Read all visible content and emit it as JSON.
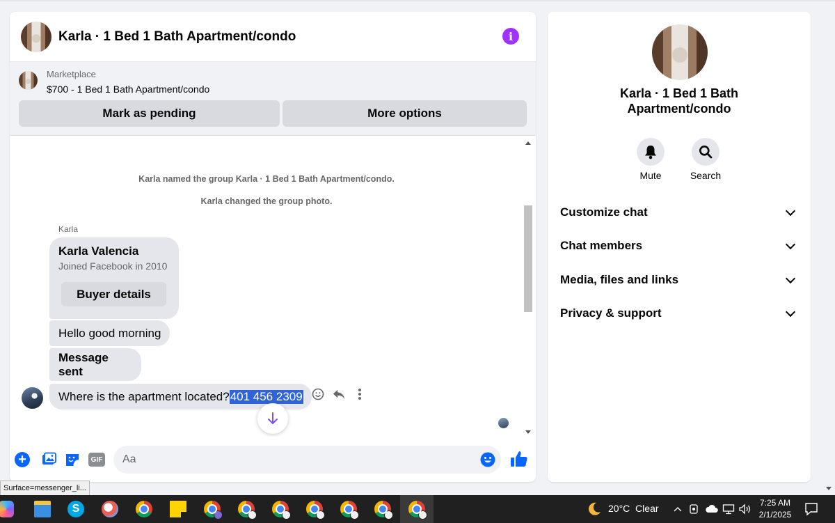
{
  "chat": {
    "title": "Karla · 1 Bed 1 Bath Apartment/condo",
    "info_glyph": "i",
    "marketplace": {
      "label": "Marketplace",
      "item": "$700 - 1 Bed 1 Bath Apartment/condo",
      "pending_label": "Mark as pending",
      "more_label": "More options"
    },
    "system_messages": [
      "Karla named the group Karla · 1 Bed 1 Bath Apartment/condo.",
      "Karla changed the group photo."
    ],
    "sender_name": "Karla",
    "profile_card": {
      "name": "Karla Valencia",
      "subtitle": "Joined Facebook in 2010",
      "button_label": "Buyer details"
    },
    "messages": [
      {
        "text": "Hello good morning"
      },
      {
        "text": "Message sent"
      },
      {
        "text": "Where is the apartment located?",
        "highlighted": "401 456 2309"
      }
    ],
    "composer": {
      "placeholder": "Aa",
      "gif_label": "GIF"
    }
  },
  "side": {
    "title": "Karla · 1 Bed 1 Bath Apartment/condo",
    "actions": [
      {
        "label": "Mute",
        "icon": "bell-icon"
      },
      {
        "label": "Search",
        "icon": "search-icon"
      }
    ],
    "sections": [
      {
        "label": "Customize chat"
      },
      {
        "label": "Chat members"
      },
      {
        "label": "Media, files and links"
      },
      {
        "label": "Privacy & support"
      }
    ]
  },
  "status_tooltip": "Surface=messenger_li...",
  "taskbar": {
    "weather": "20°C  Clear",
    "time": "7:25 AM",
    "date": "2/1/2025"
  },
  "colors": {
    "accent_blue": "#0866ff",
    "info_purple": "#a033ff",
    "highlight": "#2f64d8"
  }
}
